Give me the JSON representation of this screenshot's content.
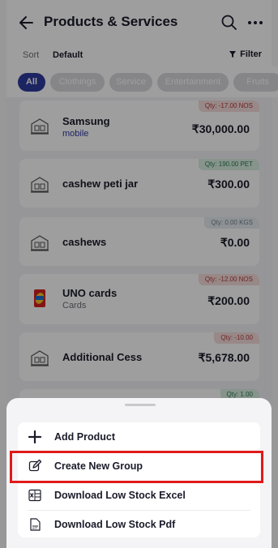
{
  "header": {
    "title": "Products & Services"
  },
  "sort": {
    "label": "Sort",
    "value": "Default",
    "filter_label": "Filter"
  },
  "chips": [
    "All",
    "Clothings",
    "Service",
    "Entertainment",
    "Fruits"
  ],
  "products": [
    {
      "name": "Samsung",
      "category": "mobile",
      "qty": "Qty: -17.00 NOS",
      "qty_status": "negative",
      "price": "₹30,000.00",
      "icon": "generic-product-icon"
    },
    {
      "name": "cashew peti jar",
      "category": "",
      "qty": "Qty: 190.00 PET",
      "qty_status": "positive",
      "price": "₹300.00",
      "icon": "generic-product-icon"
    },
    {
      "name": "cashews",
      "category": "",
      "qty": "Qty: 0.00 KGS",
      "qty_status": "zero",
      "price": "₹0.00",
      "icon": "generic-product-icon"
    },
    {
      "name": "UNO cards",
      "category": "Cards",
      "qty": "Qty: -12.00 NOS",
      "qty_status": "negative",
      "price": "₹200.00",
      "icon": "uno-cards-image"
    },
    {
      "name": "Additional Cess",
      "category": "",
      "qty": "Qty: -10.00",
      "qty_status": "negative",
      "price": "₹5,678.00",
      "icon": "generic-product-icon"
    },
    {
      "name": "",
      "category": "",
      "qty": "Qty: 1.00",
      "qty_status": "positive",
      "price": "",
      "icon": ""
    }
  ],
  "sheet_menu": [
    {
      "label": "Add Product",
      "icon": "plus-icon"
    },
    {
      "label": "Create New Group",
      "icon": "edit-icon"
    },
    {
      "label": "Download Low Stock Excel",
      "icon": "excel-icon"
    },
    {
      "label": "Download Low Stock Pdf",
      "icon": "pdf-icon"
    }
  ],
  "colors": {
    "accent": "#2e3a9f",
    "highlight": "#e01a1a"
  }
}
